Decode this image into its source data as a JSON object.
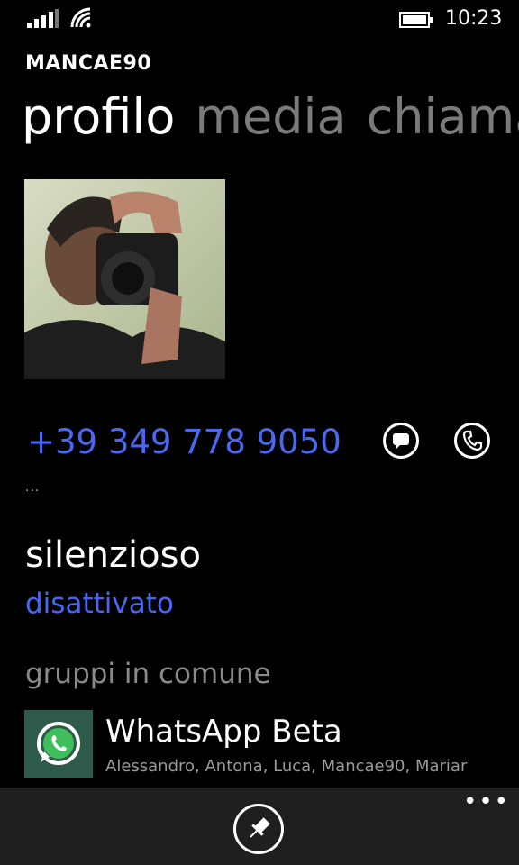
{
  "status_bar": {
    "time": "10:23",
    "icons": [
      "signal-icon",
      "wifi-icon",
      "battery-icon"
    ]
  },
  "app": {
    "title": "MANCAE90"
  },
  "pivot": {
    "tabs": [
      {
        "label": "profilo",
        "active": true
      },
      {
        "label": "media",
        "active": false
      },
      {
        "label": "chiama",
        "active": false
      }
    ]
  },
  "profile": {
    "phone": "+39 349 778 9050",
    "ellipsis": "...",
    "silent_label": "silenzioso",
    "silent_value": "disattivato",
    "groups_header": "gruppi in comune",
    "groups": [
      {
        "name": "WhatsApp Beta",
        "members": "Alessandro, Antona, Luca, Mancae90, Mariar",
        "icon": "whatsapp-icon"
      }
    ],
    "actions": [
      "message-icon",
      "phone-icon"
    ]
  },
  "appbar": {
    "primary_icon": "pin-icon",
    "more": "•••"
  },
  "colors": {
    "background": "#000000",
    "accent": "#4a67f0",
    "inactive_text": "#7a7a7a",
    "appbar": "#1f1f1f"
  }
}
